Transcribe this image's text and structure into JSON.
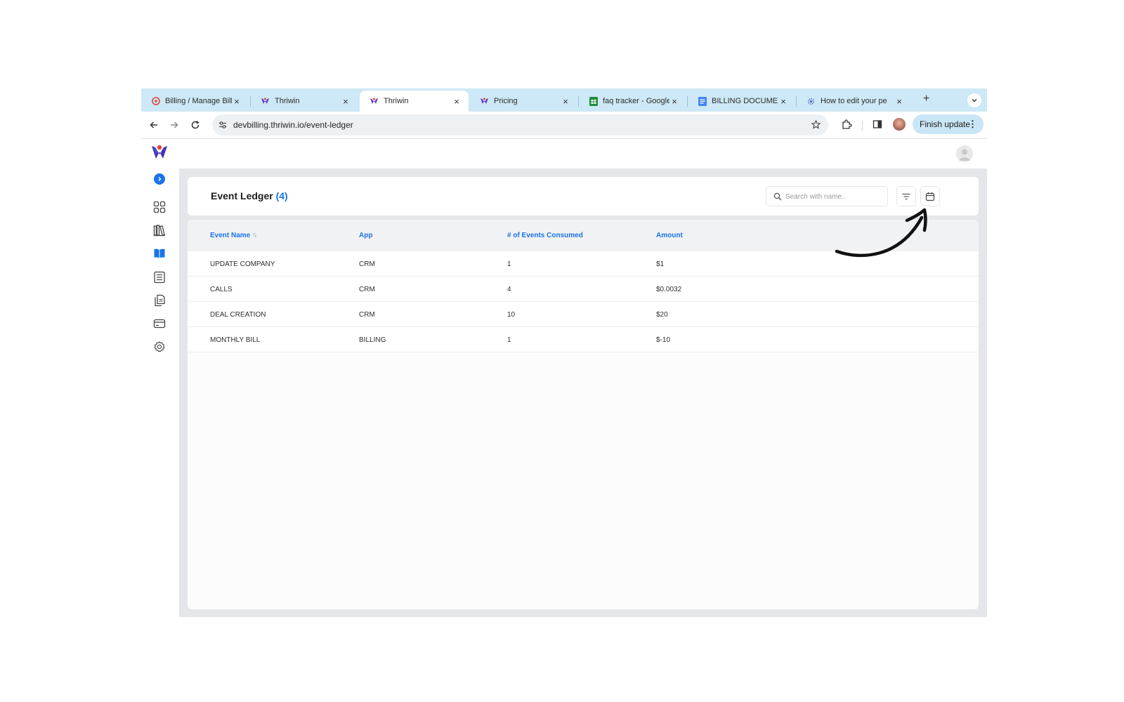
{
  "browser": {
    "tabs": [
      {
        "title": "Billing / Manage Billi",
        "favicon": "billing-favicon",
        "active": false
      },
      {
        "title": "Thriwin",
        "favicon": "thriwin-favicon",
        "active": false
      },
      {
        "title": "Thriwin",
        "favicon": "thriwin-favicon",
        "active": true
      },
      {
        "title": "Pricing",
        "favicon": "thriwin-favicon",
        "active": false
      },
      {
        "title": "faq tracker - Google",
        "favicon": "sheets-favicon",
        "active": false
      },
      {
        "title": "BILLING DOCUMEN",
        "favicon": "docs-favicon",
        "active": false
      },
      {
        "title": "How to edit your pe",
        "favicon": "gear-favicon",
        "active": false
      }
    ],
    "close_glyph": "×",
    "new_tab_glyph": "+",
    "url": "devbilling.thriwin.io/event-ledger",
    "finish_update_label": "Finish update",
    "colors": {
      "tabstrip": "#cde8f6",
      "finish_button": "#c9e6f6"
    }
  },
  "sidebar": {
    "items": [
      {
        "name": "dashboard",
        "icon": "grid-icon",
        "active": false
      },
      {
        "name": "library",
        "icon": "books-icon",
        "active": false
      },
      {
        "name": "event-ledger",
        "icon": "open-book-icon",
        "active": true
      },
      {
        "name": "list",
        "icon": "list-icon",
        "active": false
      },
      {
        "name": "documents",
        "icon": "documents-icon",
        "active": false
      },
      {
        "name": "billing",
        "icon": "credit-card-icon",
        "active": false
      },
      {
        "name": "settings",
        "icon": "gear-icon",
        "active": false
      }
    ]
  },
  "page": {
    "title": "Event Ledger",
    "count": "(4)",
    "search_placeholder": "Search with name..",
    "accent": "#1a73e8"
  },
  "table": {
    "columns": [
      "Event Name",
      "App",
      "# of Events Consumed",
      "Amount"
    ],
    "rows": [
      [
        "UPDATE COMPANY",
        "CRM",
        "1",
        "$1"
      ],
      [
        "CALLS",
        "CRM",
        "4",
        "$0.0032"
      ],
      [
        "DEAL CREATION",
        "CRM",
        "10",
        "$20"
      ],
      [
        "MONTHLY BILL",
        "BILLING",
        "1",
        "$-10"
      ]
    ]
  }
}
